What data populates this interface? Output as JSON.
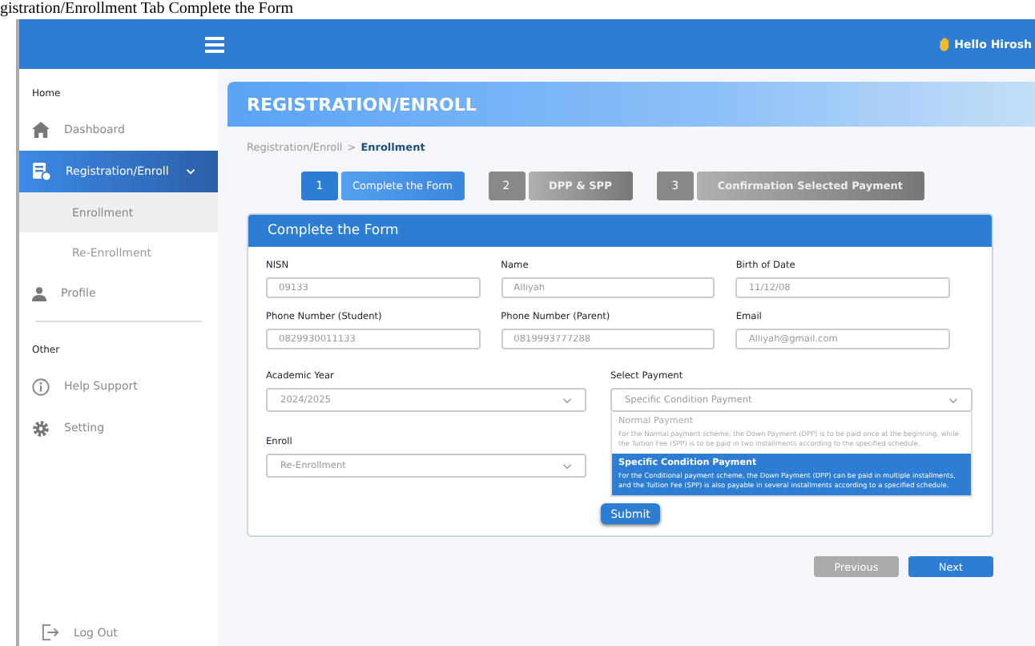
{
  "caption": "gistration/Enrollment Tab Complete the Form",
  "topbar": {
    "greeting": "Hello Hirosh"
  },
  "sidebar": {
    "sections": [
      {
        "label": "Home",
        "items": [
          {
            "label": "Dashboard",
            "selected": false
          },
          {
            "label": "Registration/Enroll",
            "selected": true,
            "expanded": true,
            "children": [
              {
                "label": "Enrollment",
                "selected": true
              },
              {
                "label": "Re-Enrollment",
                "selected": false
              }
            ]
          },
          {
            "label": "Profile",
            "selected": false
          }
        ]
      },
      {
        "label": "Other",
        "items": [
          {
            "label": "Help Support",
            "selected": false
          },
          {
            "label": "Setting",
            "selected": false
          }
        ]
      }
    ],
    "logout": "Log Out"
  },
  "page": {
    "title": "REGISTRATION/ENROLL",
    "breadcrumb": {
      "items": [
        "Registration/Enroll",
        "Enrollment"
      ],
      "separator": ">"
    }
  },
  "steps": [
    {
      "number": "1",
      "label": "Complete the Form",
      "selected": true
    },
    {
      "number": "2",
      "label": "DPP & SPP",
      "selected": false
    },
    {
      "number": "3",
      "label": "Confirmation Selected Payment",
      "selected": false
    }
  ],
  "form": {
    "title": "Complete the Form",
    "fields": [
      {
        "label": "NISN",
        "value": "09133"
      },
      {
        "label": "Name",
        "value": "Alliyah"
      },
      {
        "label": "Birth of Date",
        "value": "11/12/08"
      },
      {
        "label": "Phone Number (Student)",
        "value": "0829930011133"
      },
      {
        "label": "Phone Number (Parent)",
        "value": "0819993777288"
      },
      {
        "label": "Email",
        "value": "Alliyah@gmail.com"
      }
    ],
    "selects": [
      {
        "label": "Academic Year",
        "value": "2024/2025"
      },
      {
        "label": "Enroll",
        "value": "Re-Enrollment"
      }
    ],
    "payment": {
      "label": "Select Payment",
      "value": "Specific Condition Payment",
      "expanded": true,
      "options": [
        {
          "title": "Normal Payment",
          "description": "For the Normal payment scheme, the Down Payment (DPP) is to be paid once at the beginning, while the Tuition Fee (SPP) is to be paid in two installments according to the specified schedule.",
          "selected": false
        },
        {
          "title": "Specific Condition Payment",
          "description": "For the Conditional payment scheme, the Down Payment (DPP) can be paid in multiple installments, and the Tuition Fee (SPP) is also payable in several installments according to a specified schedule.",
          "selected": true
        }
      ]
    },
    "submit": "Submit"
  },
  "nav": {
    "previous": "Previous",
    "next": "Next"
  }
}
